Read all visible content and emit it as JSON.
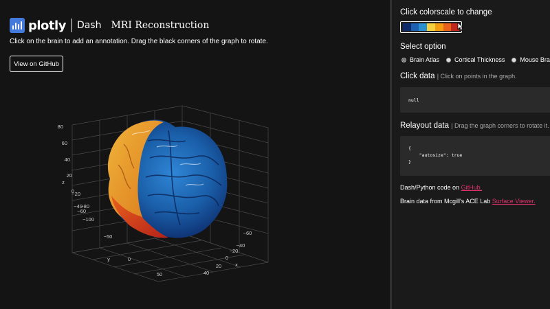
{
  "header": {
    "plotly_label": "plotly",
    "dash_label": "Dash",
    "app_title": "MRI Reconstruction",
    "instructions": "Click on the brain to add an annotation. Drag the black corners of the graph to rotate.",
    "github_button": "View on GitHub"
  },
  "graph": {
    "z_axis": {
      "title": "z",
      "ticks": [
        "80",
        "60",
        "40",
        "20",
        "0",
        "−20",
        "−40",
        "−60",
        "−80",
        "−100"
      ]
    },
    "y_axis": {
      "title": "y",
      "ticks": [
        "−50",
        "0",
        "50"
      ]
    },
    "x_axis": {
      "title": "x",
      "ticks": [
        "−60",
        "−40",
        "−20",
        "0",
        "20",
        "40"
      ]
    },
    "colors": {
      "background": "#141414",
      "grid": "#4a4a4a",
      "tick": "#cccccc"
    }
  },
  "controls": {
    "colorscale_title": "Click colorscale to change",
    "colorscale_swatches": [
      "#0d2b6b",
      "#1f5fb0",
      "#2a8fd0",
      "#f4d03f",
      "#f39c12",
      "#e8601c",
      "#c0281c"
    ],
    "select_title": "Select option",
    "options": [
      {
        "label": "Brain Atlas",
        "checked": true
      },
      {
        "label": "Cortical Thickness",
        "checked": false
      },
      {
        "label": "Mouse Brain",
        "checked": false
      }
    ],
    "click_data": {
      "title": "Click data",
      "hint": "Click on points in the graph.",
      "content": "null"
    },
    "relayout_data": {
      "title": "Relayout data",
      "hint": "Drag the graph corners to rotate it.",
      "content": "{\n    \"autosize\": true\n}"
    },
    "footer": {
      "code_prefix": "Dash/Python code on ",
      "code_link": "GitHub.",
      "data_prefix": "Brain data from Mcgill's ACE Lab ",
      "data_link": "Surface Viewer."
    }
  }
}
